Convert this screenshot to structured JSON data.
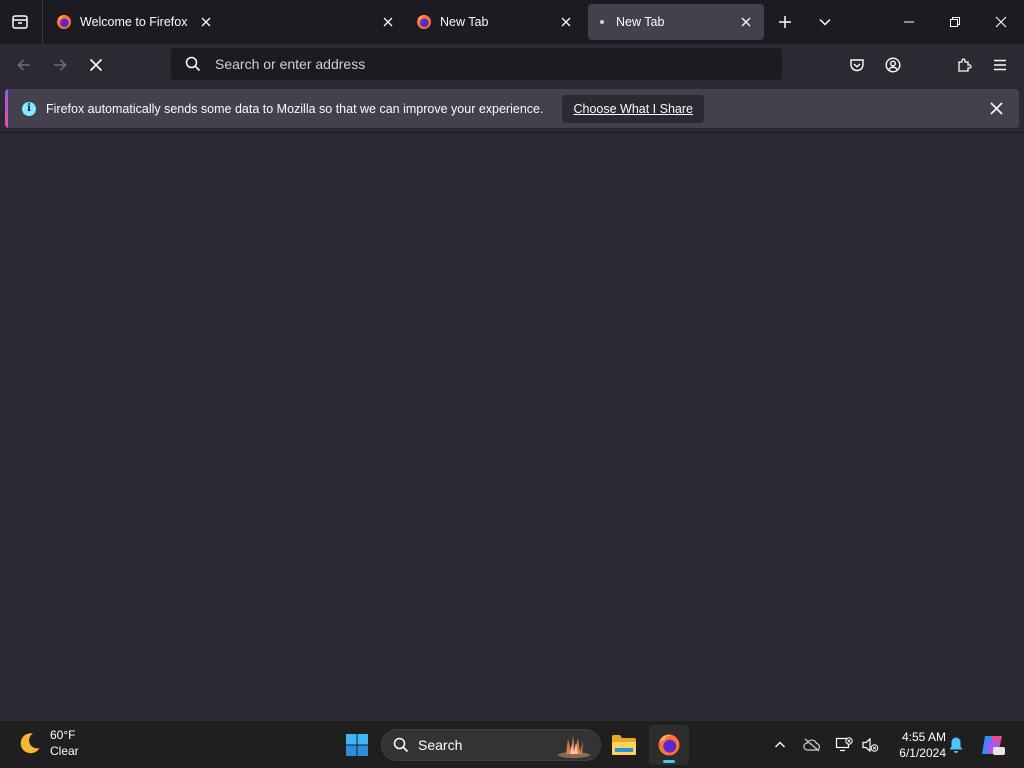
{
  "tabs": [
    {
      "title": "Welcome to Firefox",
      "icon": "firefox-icon",
      "selected": false
    },
    {
      "title": "New Tab",
      "icon": "firefox-icon",
      "selected": false
    },
    {
      "title": "New Tab",
      "icon": "loading-dot",
      "selected": true
    }
  ],
  "urlbar": {
    "placeholder": "Search or enter address",
    "value": ""
  },
  "notification": {
    "message": "Firefox automatically sends some data to Mozilla so that we can improve your experience.",
    "button": "Choose What I Share"
  },
  "taskbar": {
    "weather": {
      "temp": "60°F",
      "condition": "Clear",
      "icon": "moon-icon"
    },
    "search_label": "Search",
    "clock": {
      "time": "4:55 AM",
      "date": "6/1/2024"
    }
  },
  "colors": {
    "accent": "#9059ff",
    "tab_selected": "#42414d",
    "toolbar": "#2b2a33",
    "taskbar_indicator": "#4cc2ff"
  }
}
